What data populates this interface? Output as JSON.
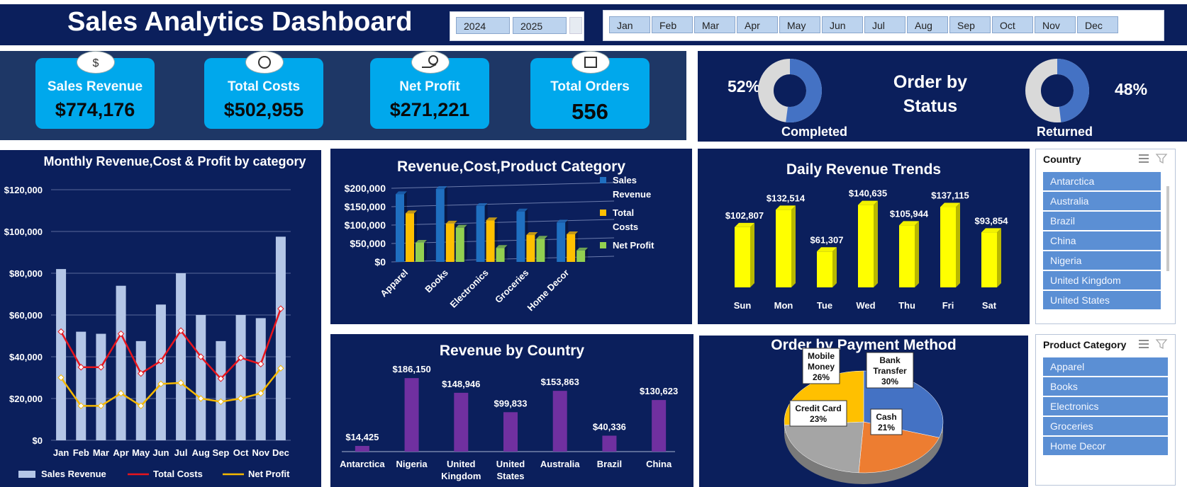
{
  "title": "Sales Analytics Dashboard",
  "years": [
    "2024",
    "2025"
  ],
  "months": [
    "Jan",
    "Feb",
    "Mar",
    "Apr",
    "May",
    "Jun",
    "Jul",
    "Aug",
    "Sep",
    "Oct",
    "Nov",
    "Dec"
  ],
  "kpis": [
    {
      "label": "Sales Revenue",
      "value": "$774,176",
      "icon": "money-bag-icon"
    },
    {
      "label": "Total Costs",
      "value": "$502,955",
      "icon": "coins-icon"
    },
    {
      "label": "Net Profit",
      "value": "$271,221",
      "icon": "hand-coin-icon"
    },
    {
      "label": "Total Orders",
      "value": "556",
      "icon": "orders-icon"
    }
  ],
  "status": {
    "title_line1": "Order by",
    "title_line2": "Status",
    "completed_pct": "52%",
    "completed_label": "Completed",
    "returned_pct": "48%",
    "returned_label": "Returned"
  },
  "colors": {
    "navy": "#0b1f5c",
    "kpi": "#00a8ec",
    "revenue_bar": "#b4c6e7",
    "cost_line": "#e8141c",
    "profit_line": "#f5b800",
    "purple": "#7030a0",
    "yellow": "#ffff00",
    "cat_rev": "#1f6fc0",
    "cat_cost": "#ffc000",
    "cat_profit": "#92d050"
  },
  "country_filter": {
    "header": "Country",
    "items": [
      "Antarctica",
      "Australia",
      "Brazil",
      "China",
      "Nigeria",
      "United Kingdom",
      "United States"
    ]
  },
  "category_filter": {
    "header": "Product Category",
    "items": [
      "Apparel",
      "Books",
      "Electronics",
      "Groceries",
      "Home Decor"
    ]
  },
  "chart_data": [
    {
      "type": "bar",
      "title": "Monthly Revenue,Cost & Profit by category",
      "categories": [
        "Jan",
        "Feb",
        "Mar",
        "Apr",
        "May",
        "Jun",
        "Jul",
        "Aug",
        "Sep",
        "Oct",
        "Nov",
        "Dec"
      ],
      "ylim": [
        0,
        120000
      ],
      "yticks": [
        "$0",
        "$20,000",
        "$40,000",
        "$60,000",
        "$80,000",
        "$100,000",
        "$120,000"
      ],
      "series": [
        {
          "name": "Sales Revenue",
          "kind": "bar",
          "values": [
            82000,
            52000,
            51000,
            74000,
            47500,
            65000,
            80000,
            60000,
            47500,
            60000,
            58500,
            97500
          ]
        },
        {
          "name": "Total Costs",
          "kind": "line",
          "values": [
            52000,
            35000,
            35000,
            51000,
            32000,
            38000,
            52500,
            40000,
            29500,
            39500,
            36500,
            63000
          ]
        },
        {
          "name": "Net Profit",
          "kind": "line",
          "values": [
            30000,
            16500,
            16500,
            22500,
            16500,
            27000,
            27500,
            20000,
            18500,
            20000,
            22500,
            34500
          ]
        }
      ],
      "legend": "bottom"
    },
    {
      "type": "bar",
      "title": "Revenue,Cost,Product Category",
      "categories": [
        "Apparel",
        "Books",
        "Electronics",
        "Groceries",
        "Home Decor"
      ],
      "ylim": [
        0,
        200000
      ],
      "yticks": [
        "$0",
        "$50,000",
        "$100,000",
        "$150,000",
        "$200,000"
      ],
      "series": [
        {
          "name": "Sales Revenue",
          "values": [
            184000,
            198000,
            152000,
            137000,
            107000
          ]
        },
        {
          "name": "Total Costs",
          "values": [
            132000,
            104000,
            113000,
            73000,
            75000
          ]
        },
        {
          "name": "Net Profit",
          "values": [
            52000,
            93000,
            38000,
            63000,
            31000
          ]
        }
      ],
      "legend": "right"
    },
    {
      "type": "bar",
      "title": "Daily Revenue Trends",
      "categories": [
        "Sun",
        "Mon",
        "Tue",
        "Wed",
        "Thu",
        "Fri",
        "Sat"
      ],
      "values": [
        102807,
        132514,
        61307,
        140635,
        105944,
        137115,
        93854
      ],
      "labels": [
        "$102,807",
        "$132,514",
        "$61,307",
        "$140,635",
        "$105,944",
        "$137,115",
        "$93,854"
      ]
    },
    {
      "type": "bar",
      "title": "Revenue by Country",
      "categories": [
        "Antarctica",
        "Nigeria",
        "United Kingdom",
        "United States",
        "Australia",
        "Brazil",
        "China"
      ],
      "values": [
        14425,
        186150,
        148946,
        99833,
        153863,
        40336,
        130623
      ],
      "labels": [
        "$14,425",
        "$186,150",
        "$148,946",
        "$99,833",
        "$153,863",
        "$40,336",
        "$130,623"
      ]
    },
    {
      "type": "pie",
      "title": "Order by Payment Method",
      "categories": [
        "Bank Transfer",
        "Cash",
        "Credit Card",
        "Mobile Money"
      ],
      "values": [
        30,
        21,
        23,
        26
      ],
      "labels": [
        "30%",
        "21%",
        "23%",
        "26%"
      ]
    },
    {
      "type": "pie",
      "title": "Order by Status",
      "categories": [
        "Completed",
        "Returned"
      ],
      "values": [
        52,
        48
      ]
    }
  ]
}
